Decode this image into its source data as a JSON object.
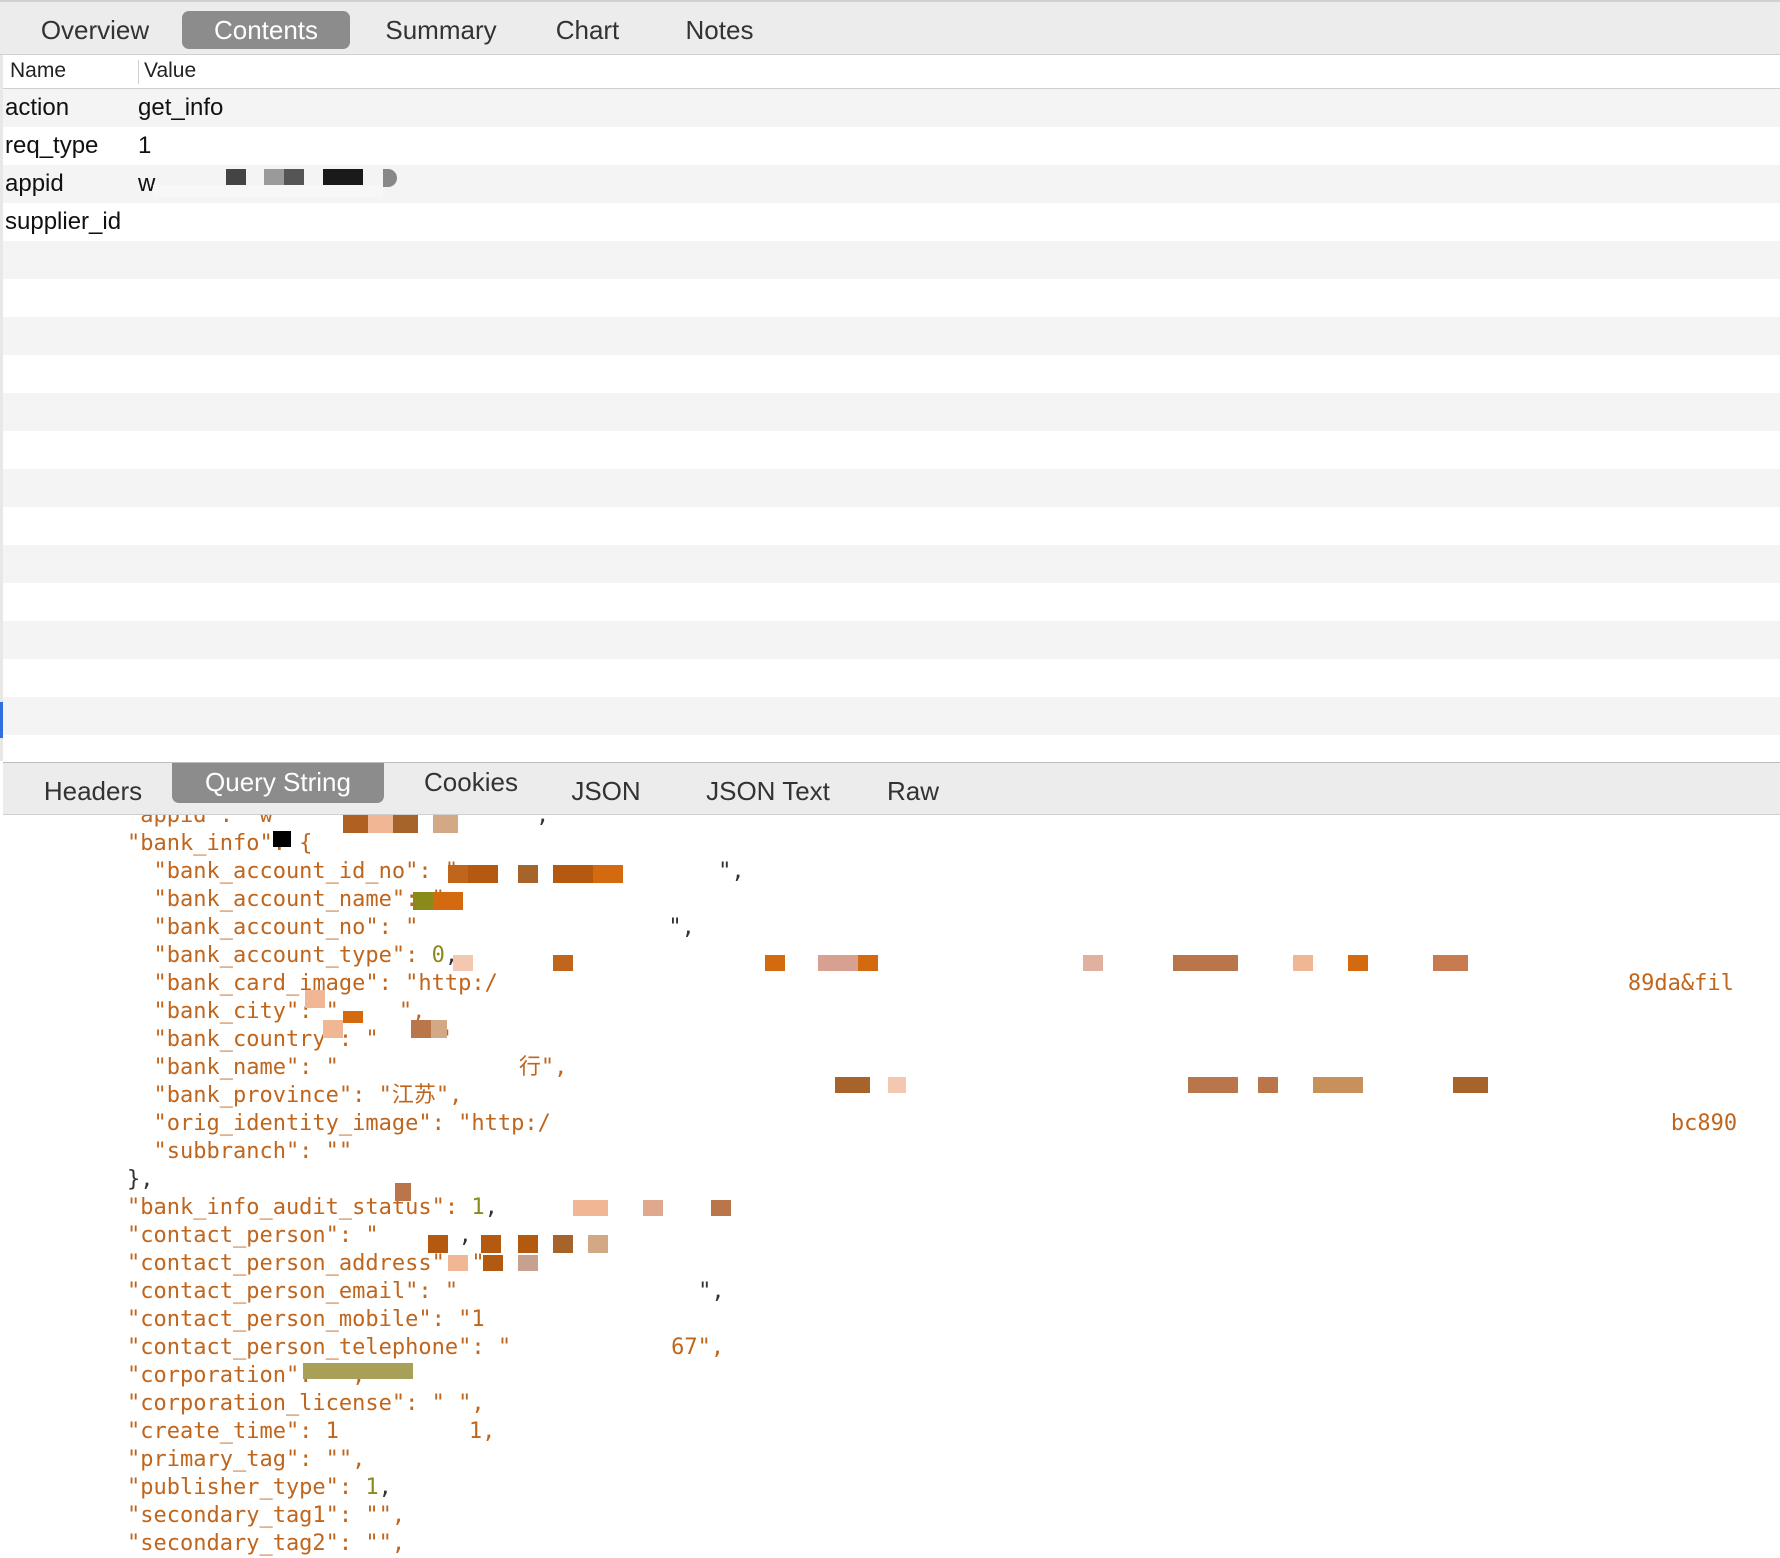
{
  "top_tabs": [
    "Overview",
    "Contents",
    "Summary",
    "Chart",
    "Notes"
  ],
  "top_active_tab": "Contents",
  "table": {
    "headers": {
      "name": "Name",
      "value": "Value"
    },
    "rows": [
      {
        "name": "action",
        "value": "get_info"
      },
      {
        "name": "req_type",
        "value": "1"
      },
      {
        "name": "appid",
        "value": "w"
      },
      {
        "name": "supplier_id",
        "value": ""
      }
    ]
  },
  "bottom_tabs": [
    "Headers",
    "Query String",
    "Cookies",
    "JSON",
    "JSON Text",
    "Raw"
  ],
  "bottom_active_tab": "Query String",
  "json_lines": [
    {
      "text": "\"appid\": \"w",
      "tail": "\","
    },
    {
      "text": "\"bank_info\": {",
      "tail": ""
    },
    {
      "text": "  \"bank_account_id_no\": \"",
      "tail": "\","
    },
    {
      "text": "  \"bank_account_name\": \"",
      "tail": ""
    },
    {
      "text": "  \"bank_account_no\": \"",
      "tail": "\","
    },
    {
      "text": "  \"bank_account_type\": ",
      "num": "0",
      "tail": ","
    },
    {
      "text": "  \"bank_card_image\": \"http:/",
      "tail": "89da&fil"
    },
    {
      "text": "  \"bank_city\": \"",
      "tail": "\","
    },
    {
      "text": "  \"bank_country\": \"",
      "tail": "\""
    },
    {
      "text": "  \"bank_name\": \"",
      "tail": "行\","
    },
    {
      "text": "  \"bank_province\": \"江苏\",",
      "tail": ""
    },
    {
      "text": "  \"orig_identity_image\": \"http:/",
      "tail": "bc890"
    },
    {
      "text": "  \"subbranch\": \"\"",
      "tail": ""
    },
    {
      "text": "},",
      "tail": ""
    },
    {
      "text": "\"bank_info_audit_status\": ",
      "num": "1",
      "tail": ","
    },
    {
      "text": "\"contact_person\": \"",
      "tail": ","
    },
    {
      "text": "\"contact_person_address\": \"",
      "tail": ""
    },
    {
      "text": "\"contact_person_email\": \"",
      "tail": "\","
    },
    {
      "text": "\"contact_person_mobile\": \"1",
      "tail": ""
    },
    {
      "text": "\"contact_person_telephone\": \"",
      "tail": "67\","
    },
    {
      "text": "\"corporation\": \"\",",
      "tail": ""
    },
    {
      "text": "\"corporation_license\": \" \",",
      "tail": ""
    },
    {
      "text": "\"create_time\": 1",
      "tail": "1,"
    },
    {
      "text": "\"primary_tag\": \"\",",
      "tail": ""
    },
    {
      "text": "\"publisher_type\": ",
      "num": "1",
      "tail": ","
    },
    {
      "text": "\"secondary_tag1\": \"\",",
      "tail": ""
    },
    {
      "text": "\"secondary_tag2\": \"\",",
      "tail": ""
    }
  ],
  "colors": {
    "json_key": "#c0651c",
    "json_number": "#8a8a1a",
    "active_tab_bg": "#8c8c8c",
    "row_stripe": "#f4f4f4"
  }
}
